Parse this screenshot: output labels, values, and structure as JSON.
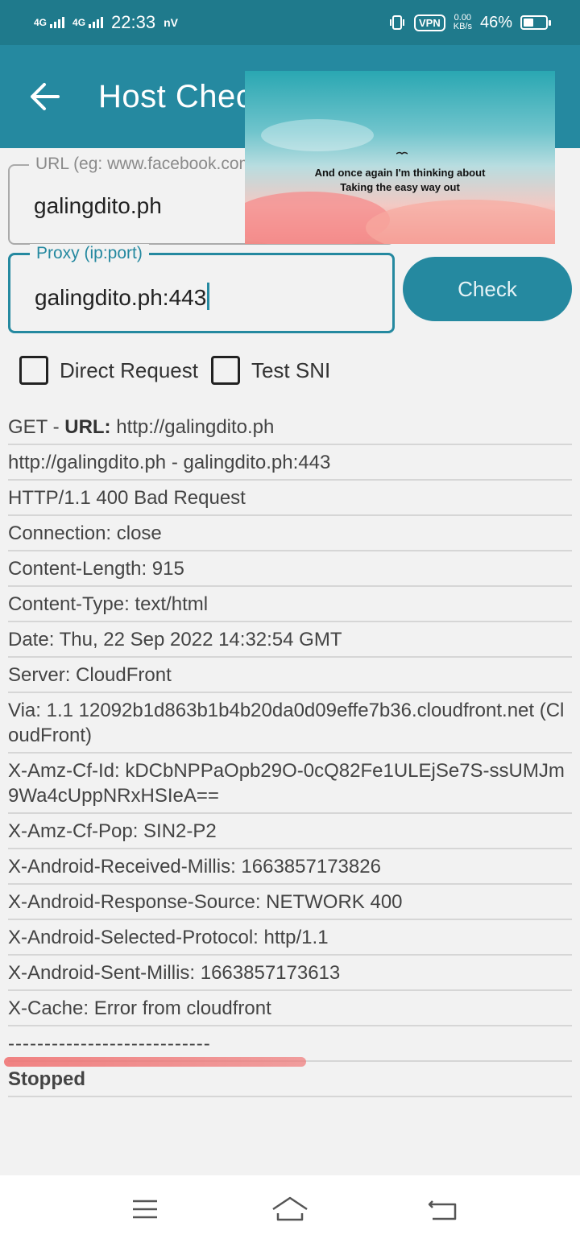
{
  "status_bar": {
    "signal1": "4G",
    "signal2": "4G",
    "time": "22:33",
    "carrier_mark": "nV",
    "vpn": "VPN",
    "speed_value": "0.00",
    "speed_unit": "KB/s",
    "battery_percent": "46%",
    "battery_level": 0.46
  },
  "toolbar": {
    "title": "Host Checker",
    "back_icon": "arrow-left-icon"
  },
  "form": {
    "url_label": "URL (eg: www.facebook.com)",
    "url_value": "galingdito.ph",
    "proxy_label": "Proxy (ip:port)",
    "proxy_value": "galingdito.ph:443",
    "check_label": "Check",
    "direct_request_label": "Direct Request",
    "test_sni_label": "Test SNI",
    "direct_request_checked": false,
    "test_sni_checked": false
  },
  "overlay": {
    "line1": "And once again I'm thinking about",
    "line2": "Taking the easy way out"
  },
  "log": {
    "first_prefix": "GET - ",
    "first_key": "URL:",
    "first_value": " http://galingdito.ph",
    "rows": [
      "http://galingdito.ph - galingdito.ph:443",
      "HTTP/1.1 400 Bad Request",
      "Connection: close",
      "Content-Length: 915",
      "Content-Type: text/html",
      "Date: Thu, 22 Sep 2022 14:32:54 GMT",
      "Server: CloudFront",
      "Via: 1.1 12092b1d863b1b4b20da0d09effe7b36.cloudfront.net (CloudFront)",
      "X-Amz-Cf-Id: kDCbNPPaOpb29O-0cQ82Fe1ULEjSe7S-ssUMJm9Wa4cUppNRxHSIeA==",
      "X-Amz-Cf-Pop: SIN2-P2",
      "X-Android-Received-Millis: 1663857173826",
      "X-Android-Response-Source: NETWORK 400",
      "X-Android-Selected-Protocol: http/1.1",
      "X-Android-Sent-Millis: 1663857173613",
      "X-Cache: Error from cloudfront"
    ],
    "separator": "----------------------------",
    "status": "Stopped"
  },
  "nav": {
    "menu_icon": "menu-icon",
    "home_icon": "home-icon",
    "back_icon": "back-nav-icon"
  },
  "colors": {
    "primary": "#2589a0",
    "status_bar": "#1f7a8c",
    "annotation": "#f07070"
  }
}
